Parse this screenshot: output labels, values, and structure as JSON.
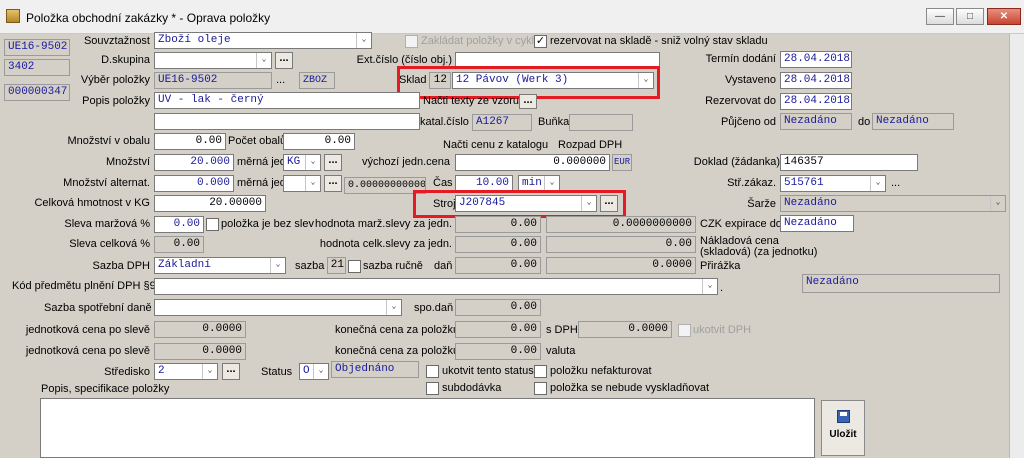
{
  "window": {
    "title": "Položka obchodní zakázky *  - Oprava položky",
    "minimize": "—",
    "maximize": "□",
    "close": "✕"
  },
  "left_stubs": [
    "UE16-9502",
    "3402",
    "000000347"
  ],
  "fields": {
    "souvztaznost": {
      "label": "Souvztažnost",
      "value": "Zboží oleje"
    },
    "dskupina": {
      "label": "D.skupina",
      "value": ""
    },
    "vyber": {
      "label": "Výběr položky",
      "value": "UE16-9502",
      "ellipsis": "...",
      "code": "ZBOZ"
    },
    "popis": {
      "label": "Popis položky",
      "value": "UV - lak - černý",
      "value2": ""
    },
    "zakladat": {
      "label": "Zakládat položky v cyklu"
    },
    "rezervovat": {
      "label": "rezervovat na skladě - sniž volný stav skladu"
    },
    "ext_cislo": {
      "label": "Ext.číslo (číslo obj.)",
      "value": ""
    },
    "sklad": {
      "label": "Sklad",
      "num": "12",
      "value": "12 Pávov (Werk 3)"
    },
    "nacti_texty": {
      "label": "Načti texty ze vzoru"
    },
    "katal": {
      "label": "katal.číslo",
      "value": "A1267"
    },
    "bunka": {
      "label": "Buňka",
      "value": ""
    },
    "termin": {
      "label": "Termín dodání",
      "value": "28.04.2018"
    },
    "vystaveno": {
      "label": "Vystaveno",
      "value": "28.04.2018"
    },
    "rezervovat_do": {
      "label": "Rezervovat do",
      "value": "28.04.2018"
    },
    "pujceno": {
      "label": "Půjčeno od",
      "value": "Nezadáno",
      "do_label": "do",
      "do_value": "Nezadáno"
    },
    "mnozstvi_obalu": {
      "label": "Množství v obalu",
      "value": "0.00"
    },
    "pocet_obalu": {
      "label": "Počet obalů",
      "value": "0.00"
    },
    "mnozstvi": {
      "label": "Množství",
      "value": "20.000"
    },
    "merna": {
      "label": "měrná jed.",
      "value": "KG"
    },
    "mnozstvi_alt": {
      "label": "Množství alternat.",
      "value": "0.000"
    },
    "merna2": {
      "label": "měrná jed.",
      "value": "",
      "factor": "0.00000000000"
    },
    "hmotnost": {
      "label": "Celková hmotnost v KG",
      "value": "20.00000"
    },
    "nacti_cenu": {
      "label": "Načti cenu z katalogu"
    },
    "rozpad": {
      "label": "Rozpad DPH"
    },
    "vychozi": {
      "label": "výchozí jedn.cena",
      "value": "0.000000",
      "currency": "EUR"
    },
    "cas": {
      "label": "Čas",
      "value": "10.00",
      "unit": "min"
    },
    "stroj": {
      "label": "Stroj",
      "value": "J207845"
    },
    "doklad": {
      "label": "Doklad (žádanka)",
      "value": "146357"
    },
    "str_zakaz": {
      "label": "Stř.zákaz.",
      "value": "515761"
    },
    "sarze": {
      "label": "Šarže",
      "value": "Nezadáno"
    },
    "sleva_marz": {
      "label": "Sleva  maržová %",
      "value": "0.00"
    },
    "bez_slev": {
      "label": "položka je bez slev"
    },
    "hodnota_marz": {
      "label": "hodnota marž.slevy za jedn.",
      "value": "0.00",
      "value2": "0.0000000000"
    },
    "czk": {
      "label": "CZK  expirace do",
      "value": "Nezadáno"
    },
    "sleva_celk": {
      "label": "Sleva  celková %",
      "value": "0.00"
    },
    "hodnota_celk": {
      "label": "hodnota celk.slevy za jedn.",
      "value": "0.00",
      "value2": "0.00"
    },
    "naklad": {
      "label": "Nákladová cena (skladová) (za jednotku)"
    },
    "sazba_dph": {
      "label": "Sazba DPH",
      "value": "Základní",
      "sazba_label": "sazba",
      "sazba": "21",
      "rucne": "sazba ručně",
      "dan_label": "daň",
      "dan": "0.00",
      "dan2": "0.0000"
    },
    "prirazka": {
      "label": "Přirážka"
    },
    "kod": {
      "label": "Kód předmětu plnění DPH §92a",
      "value": "",
      "nezadano": "Nezadáno"
    },
    "spotrebni": {
      "label": "Sazba spotřební daně",
      "value": "",
      "spo_label": "spo.daň",
      "spo": "0.00"
    },
    "jedn_po_sleve1": {
      "label": "jednotková cena po slevě",
      "value": "0.0000",
      "konecna_label": "konečná cena za položku",
      "konecna": "0.00",
      "sdph_label": "s DPH",
      "sdph": "0.0000",
      "ukotvit_label": "ukotvit DPH"
    },
    "jedn_po_sleve2": {
      "label": "jednotková cena po slevě",
      "value": "0.0000",
      "konecna_label": "konečná cena za položku",
      "konecna": "0.00",
      "valuta_label": "valuta"
    },
    "stredisko": {
      "label": "Středisko",
      "value": "2"
    },
    "status": {
      "label": "Status",
      "code": "O",
      "value": "Objednáno"
    },
    "ukotvit_status": {
      "label": "ukotvit tento status"
    },
    "nefakturovat": {
      "label": "položku nefakturovat"
    },
    "subdodavka": {
      "label": "subdodávka"
    },
    "nevyskladnovat": {
      "label": "položka se nebude vyskladňovat"
    },
    "popis_spec": {
      "label": "Popis, specifikace položky"
    }
  },
  "save_button": {
    "label": "Uložit",
    "icon": "floppy-disk-icon"
  },
  "highlight_color": "#e41b23"
}
